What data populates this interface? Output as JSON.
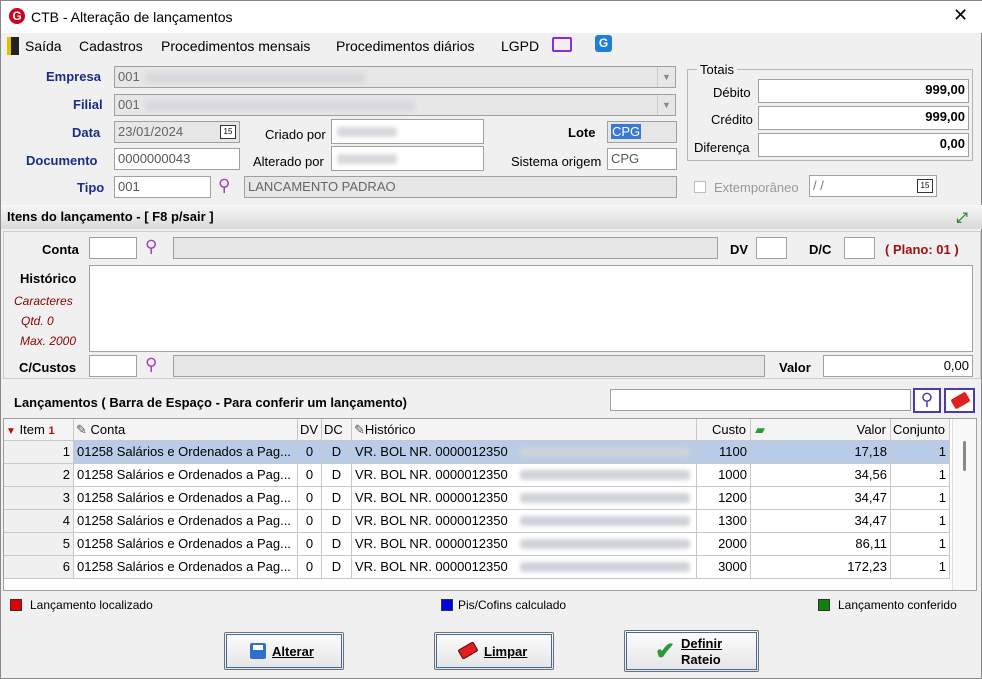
{
  "window": {
    "title": "CTB - Alteração de lançamentos",
    "close": "✕"
  },
  "menu": {
    "exit": "Saída",
    "cadastros": "Cadastros",
    "mensais": "Procedimentos mensais",
    "diarios": "Procedimentos diários",
    "lgpd": "LGPD"
  },
  "header": {
    "empresa_label": "Empresa",
    "empresa": "001",
    "filial_label": "Filial",
    "filial": "001",
    "data_label": "Data",
    "data": "23/01/2024",
    "criado_label": "Criado por",
    "alterado_label": "Alterado por",
    "lote_label": "Lote",
    "lote": "CPG",
    "documento_label": "Documento",
    "documento": "0000000043",
    "sistema_label": "Sistema origem",
    "sistema": "CPG",
    "tipo_label": "Tipo",
    "tipo": "001",
    "tipo_desc": "LANCAMENTO PADRAO"
  },
  "totais": {
    "title": "Totais",
    "debito_label": "Débito",
    "debito": "999,00",
    "credito_label": "Crédito",
    "credito": "999,00",
    "diferenca_label": "Diferença",
    "diferenca": "0,00",
    "extemp_label": "Extemporâneo",
    "extemp_date": " / /"
  },
  "itens": {
    "title": "Itens do lançamento - [ F8 p/sair ]",
    "conta_label": "Conta",
    "dv_label": "DV",
    "dc_label": "D/C",
    "plano": "( Plano: 01 )",
    "historico_label": "Histórico",
    "caracteres": "Caracteres",
    "qtd": "Qtd. 0",
    "max": "Max. 2000",
    "ccustos_label": "C/Custos",
    "valor_label": "Valor",
    "valor": "0,00"
  },
  "lancamentos": {
    "title": "Lançamentos ( Barra de Espaço - Para conferir um lançamento)"
  },
  "grid": {
    "headers": {
      "item": "Item",
      "conta": "Conta",
      "dv": "DV",
      "dc": "DC",
      "historico": "Histórico",
      "custo": "Custo",
      "valor": "Valor",
      "conjunto": "Conjunto"
    },
    "rows": [
      {
        "item": "1",
        "conta": "01258 Salários e Ordenados a Pag...",
        "dv": "0",
        "dc": "D",
        "hist": "VR. BOL NR. 0000012350",
        "custo": "1100",
        "valor": "17,18",
        "conj": "1"
      },
      {
        "item": "2",
        "conta": "01258 Salários e Ordenados a Pag...",
        "dv": "0",
        "dc": "D",
        "hist": "VR. BOL NR. 0000012350",
        "custo": "1000",
        "valor": "34,56",
        "conj": "1"
      },
      {
        "item": "3",
        "conta": "01258 Salários e Ordenados a Pag...",
        "dv": "0",
        "dc": "D",
        "hist": "VR. BOL NR. 0000012350",
        "custo": "1200",
        "valor": "34,47",
        "conj": "1"
      },
      {
        "item": "4",
        "conta": "01258 Salários e Ordenados a Pag...",
        "dv": "0",
        "dc": "D",
        "hist": "VR. BOL NR. 0000012350",
        "custo": "1300",
        "valor": "34,47",
        "conj": "1"
      },
      {
        "item": "5",
        "conta": "01258 Salários e Ordenados a Pag...",
        "dv": "0",
        "dc": "D",
        "hist": "VR. BOL NR. 0000012350",
        "custo": "2000",
        "valor": "86,11",
        "conj": "1"
      },
      {
        "item": "6",
        "conta": "01258 Salários e Ordenados a Pag...",
        "dv": "0",
        "dc": "D",
        "hist": "VR. BOL NR. 0000012350",
        "custo": "3000",
        "valor": "172,23",
        "conj": "1"
      }
    ]
  },
  "legend": {
    "localizado": "Lançamento localizado",
    "pis": "Pis/Cofins calculado",
    "conferido": "Lançamento conferido",
    "red": "#e00000",
    "blue": "#0000e0",
    "green": "#108010"
  },
  "buttons": {
    "alterar": "Alterar",
    "limpar": "Limpar",
    "definir1": "Definir",
    "definir2": "Rateio"
  }
}
